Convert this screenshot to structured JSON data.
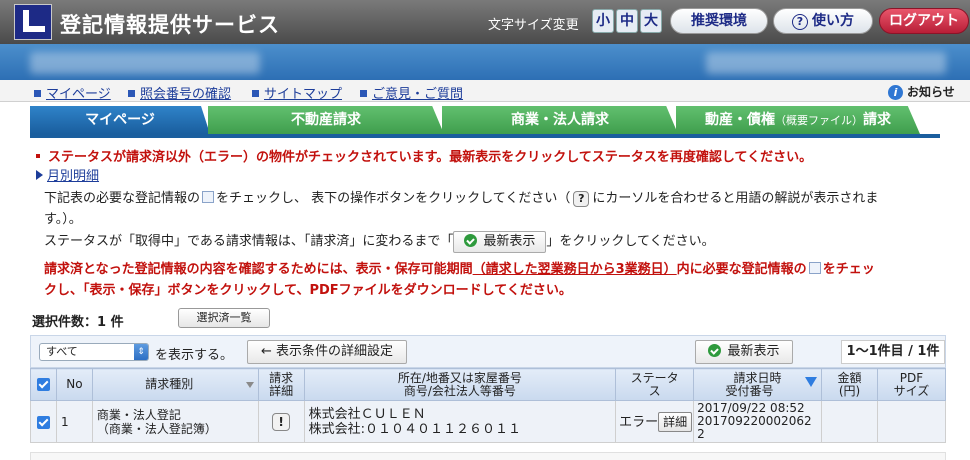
{
  "app": {
    "title": "登記情報提供サービス"
  },
  "header": {
    "font_size_label": "文字サイズ変更",
    "font_sizes": [
      "小",
      "中",
      "大"
    ],
    "recommended_env": "推奨環境",
    "how_to_use": "使い方",
    "logout": "ログアウト"
  },
  "nav": {
    "links": [
      "マイページ",
      "照会番号の確認",
      "サイトマップ",
      "ご意見・ご質問"
    ],
    "notice": "お知らせ"
  },
  "tabs": [
    {
      "label": "マイページ",
      "small": "",
      "suffix": ""
    },
    {
      "label": "不動産請求",
      "small": "",
      "suffix": ""
    },
    {
      "label": "商業・法人請求",
      "small": "",
      "suffix": ""
    },
    {
      "label": "動産・債権",
      "small": "（概要ファイル）",
      "suffix": "請求"
    }
  ],
  "messages": {
    "error": "ステータスが請求済以外（エラー）の物件がチェックされています。最新表示をクリックしてステータスを再度確認してください。",
    "monthly_link": "月別明細",
    "line1_a": "下記表の必要な登記情報の",
    "line1_b": "をチェックし、 表下の操作ボタンをクリックしてください（",
    "line1_q": "?",
    "line1_c": "にカーソルを合わせると用語の解説が表示されま",
    "line2": "す。）。",
    "line3_a": "ステータスが「取得中」である請求情報は、「請求済」に変わるまで「",
    "line3_btn": "最新表示",
    "line3_b": "」をクリックしてください。",
    "line4_a": "請求済となった登記情報の内容を確認するためには、表示・保存可能期間",
    "line4_u": "（請求した翌業務日から3業務日）",
    "line4_b": "内に必要な登記情報の",
    "line4_c": "をチェッ",
    "line5": "クし、「表示・保存」ボタンをクリックして、PDFファイルをダウンロードしてください。"
  },
  "selection": {
    "count_label": "選択件数：1 件",
    "list_button": "選択済一覧"
  },
  "filter": {
    "select_value": "すべて",
    "suffix": "を表示する。",
    "detail_button": "← 表示条件の詳細設定",
    "refresh_button": "最新表示",
    "page_indicator": "1〜1件目 / 1件"
  },
  "table": {
    "headers": {
      "no": "No",
      "type": "請求種別",
      "detail_1": "請求",
      "detail_2": "詳細",
      "loc_1": "所在/地番又は家屋番号",
      "loc_2": "商号/会社法人等番号",
      "status_1": "ステータ",
      "status_2": "ス",
      "date_1": "請求日時",
      "date_2": "受付番号",
      "amount_1": "金額",
      "amount_2": "(円)",
      "pdf_1": "PDF",
      "pdf_2": "サイズ"
    },
    "rows": [
      {
        "no": "1",
        "type_1": "商業・法人登記",
        "type_2": "（商業・法人登記簿）",
        "detail_icon": "!",
        "loc_1": "株式会社ＣＵＬＥＮ",
        "loc_2": "株式会社:０１０４０１１２６０１１",
        "status": "エラー",
        "status_detail": "詳細",
        "date": "2017/09/22 08:52",
        "receipt_1": "201709220002062",
        "receipt_2": "2",
        "amount": "",
        "pdf": ""
      }
    ]
  },
  "colors": {
    "accent": "#1a5e9e",
    "tab_green": "#3f9e4d",
    "error": "#c2110d",
    "logout": "#b81e37"
  }
}
